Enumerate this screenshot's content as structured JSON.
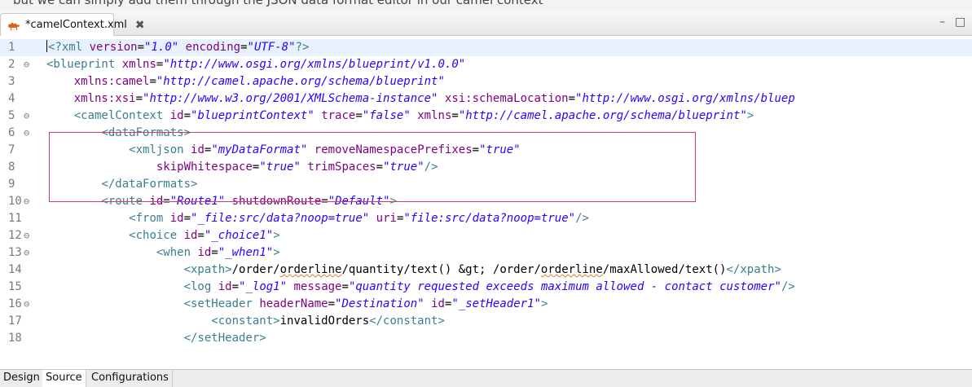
{
  "window": {
    "partial_top_text": "but we can simply add them through the JSON data format editor in our camel context"
  },
  "tab": {
    "title": "*camelContext.xml",
    "close_glyph": "✖"
  },
  "controls": {
    "minimize": "–",
    "maximize": "□"
  },
  "colors": {
    "tag": "#3a7f8f",
    "attribute": "#7f007f",
    "value": "#2a00ff",
    "highlight_box": "#d23c6a"
  },
  "lines": [
    {
      "num": "1",
      "fold": "",
      "tokens": [
        {
          "c": "t",
          "s": "<?xml"
        },
        {
          "c": "x",
          "s": " "
        },
        {
          "c": "a",
          "s": "version"
        },
        {
          "c": "x",
          "s": "="
        },
        {
          "c": "v",
          "s": "\"1.0\""
        },
        {
          "c": "x",
          "s": " "
        },
        {
          "c": "a",
          "s": "encoding"
        },
        {
          "c": "x",
          "s": "="
        },
        {
          "c": "v",
          "s": "\"UTF-8\""
        },
        {
          "c": "t",
          "s": "?>"
        }
      ]
    },
    {
      "num": "2",
      "fold": "⊖",
      "tokens": [
        {
          "c": "t",
          "s": "<blueprint"
        },
        {
          "c": "x",
          "s": " "
        },
        {
          "c": "a",
          "s": "xmlns"
        },
        {
          "c": "x",
          "s": "="
        },
        {
          "c": "v",
          "s": "\"http://www.osgi.org/xmlns/blueprint/v1.0.0\""
        }
      ]
    },
    {
      "num": "3",
      "fold": "",
      "tokens": [
        {
          "c": "x",
          "s": "    "
        },
        {
          "c": "a",
          "s": "xmlns:camel"
        },
        {
          "c": "x",
          "s": "="
        },
        {
          "c": "v",
          "s": "\"http://camel.apache.org/schema/blueprint\""
        }
      ]
    },
    {
      "num": "4",
      "fold": "",
      "tokens": [
        {
          "c": "x",
          "s": "    "
        },
        {
          "c": "a",
          "s": "xmlns:xsi"
        },
        {
          "c": "x",
          "s": "="
        },
        {
          "c": "v",
          "s": "\"http://www.w3.org/2001/XMLSchema-instance\""
        },
        {
          "c": "x",
          "s": " "
        },
        {
          "c": "a",
          "s": "xsi:schemaLocation"
        },
        {
          "c": "x",
          "s": "="
        },
        {
          "c": "v",
          "s": "\"http://www.osgi.org/xmlns/bluep"
        }
      ]
    },
    {
      "num": "5",
      "fold": "⊖",
      "tokens": [
        {
          "c": "x",
          "s": "    "
        },
        {
          "c": "t",
          "s": "<camelContext"
        },
        {
          "c": "x",
          "s": " "
        },
        {
          "c": "a",
          "s": "id"
        },
        {
          "c": "x",
          "s": "="
        },
        {
          "c": "v",
          "s": "\"blueprintContext\""
        },
        {
          "c": "x",
          "s": " "
        },
        {
          "c": "a",
          "s": "trace"
        },
        {
          "c": "x",
          "s": "="
        },
        {
          "c": "v",
          "s": "\"false\""
        },
        {
          "c": "x",
          "s": " "
        },
        {
          "c": "a",
          "s": "xmlns"
        },
        {
          "c": "x",
          "s": "="
        },
        {
          "c": "v",
          "s": "\"http://camel.apache.org/schema/blueprint\""
        },
        {
          "c": "t",
          "s": ">"
        }
      ]
    },
    {
      "num": "6",
      "fold": "⊖",
      "tokens": [
        {
          "c": "x",
          "s": "        "
        },
        {
          "c": "t",
          "s": "<dataFormats>"
        }
      ]
    },
    {
      "num": "7",
      "fold": "",
      "tokens": [
        {
          "c": "x",
          "s": "            "
        },
        {
          "c": "t",
          "s": "<xmljson"
        },
        {
          "c": "x",
          "s": " "
        },
        {
          "c": "a",
          "s": "id"
        },
        {
          "c": "x",
          "s": "="
        },
        {
          "c": "v",
          "s": "\"myDataFormat\""
        },
        {
          "c": "x",
          "s": " "
        },
        {
          "c": "a",
          "s": "removeNamespacePrefixes"
        },
        {
          "c": "x",
          "s": "="
        },
        {
          "c": "v",
          "s": "\"true\""
        }
      ]
    },
    {
      "num": "8",
      "fold": "",
      "tokens": [
        {
          "c": "x",
          "s": "                "
        },
        {
          "c": "a",
          "s": "skipWhitespace"
        },
        {
          "c": "x",
          "s": "="
        },
        {
          "c": "v",
          "s": "\"true\""
        },
        {
          "c": "x",
          "s": " "
        },
        {
          "c": "a",
          "s": "trimSpaces"
        },
        {
          "c": "x",
          "s": "="
        },
        {
          "c": "v",
          "s": "\"true\""
        },
        {
          "c": "t",
          "s": "/>"
        }
      ]
    },
    {
      "num": "9",
      "fold": "",
      "tokens": [
        {
          "c": "x",
          "s": "        "
        },
        {
          "c": "t",
          "s": "</dataFormats>"
        }
      ]
    },
    {
      "num": "10",
      "fold": "⊖",
      "tokens": [
        {
          "c": "x",
          "s": "        "
        },
        {
          "c": "t",
          "s": "<route"
        },
        {
          "c": "x",
          "s": " "
        },
        {
          "c": "a",
          "s": "id"
        },
        {
          "c": "x",
          "s": "="
        },
        {
          "c": "v",
          "s": "\"Route1\""
        },
        {
          "c": "x",
          "s": " "
        },
        {
          "c": "a",
          "s": "shutdownRoute"
        },
        {
          "c": "x",
          "s": "="
        },
        {
          "c": "v",
          "s": "\"Default\""
        },
        {
          "c": "t",
          "s": ">"
        }
      ]
    },
    {
      "num": "11",
      "fold": "",
      "tokens": [
        {
          "c": "x",
          "s": "            "
        },
        {
          "c": "t",
          "s": "<from"
        },
        {
          "c": "x",
          "s": " "
        },
        {
          "c": "a",
          "s": "id"
        },
        {
          "c": "x",
          "s": "="
        },
        {
          "c": "v",
          "s": "\"_file:src/data?noop=true\""
        },
        {
          "c": "x",
          "s": " "
        },
        {
          "c": "a",
          "s": "uri"
        },
        {
          "c": "x",
          "s": "="
        },
        {
          "c": "v",
          "s": "\"file:src/data?noop=true\""
        },
        {
          "c": "t",
          "s": "/>"
        }
      ]
    },
    {
      "num": "12",
      "fold": "⊖",
      "tokens": [
        {
          "c": "x",
          "s": "            "
        },
        {
          "c": "t",
          "s": "<choice"
        },
        {
          "c": "x",
          "s": " "
        },
        {
          "c": "a",
          "s": "id"
        },
        {
          "c": "x",
          "s": "="
        },
        {
          "c": "v",
          "s": "\"_choice1\""
        },
        {
          "c": "t",
          "s": ">"
        }
      ]
    },
    {
      "num": "13",
      "fold": "⊖",
      "tokens": [
        {
          "c": "x",
          "s": "                "
        },
        {
          "c": "t",
          "s": "<when"
        },
        {
          "c": "x",
          "s": " "
        },
        {
          "c": "a",
          "s": "id"
        },
        {
          "c": "x",
          "s": "="
        },
        {
          "c": "v",
          "s": "\"_when1\""
        },
        {
          "c": "t",
          "s": ">"
        }
      ]
    },
    {
      "num": "14",
      "fold": "",
      "tokens": [
        {
          "c": "x",
          "s": "                    "
        },
        {
          "c": "t",
          "s": "<xpath>"
        },
        {
          "c": "x",
          "s": "/order/"
        },
        {
          "c": "xs",
          "s": "orderline"
        },
        {
          "c": "x",
          "s": "/quantity/text() &gt; /order/"
        },
        {
          "c": "xs",
          "s": "orderline"
        },
        {
          "c": "x",
          "s": "/maxAllowed/text()"
        },
        {
          "c": "t",
          "s": "</xpath>"
        }
      ]
    },
    {
      "num": "15",
      "fold": "",
      "tokens": [
        {
          "c": "x",
          "s": "                    "
        },
        {
          "c": "t",
          "s": "<log"
        },
        {
          "c": "x",
          "s": " "
        },
        {
          "c": "a",
          "s": "id"
        },
        {
          "c": "x",
          "s": "="
        },
        {
          "c": "v",
          "s": "\"_log1\""
        },
        {
          "c": "x",
          "s": " "
        },
        {
          "c": "a",
          "s": "message"
        },
        {
          "c": "x",
          "s": "="
        },
        {
          "c": "v",
          "s": "\"quantity requested exceeds maximum allowed - contact customer\""
        },
        {
          "c": "t",
          "s": "/>"
        }
      ]
    },
    {
      "num": "16",
      "fold": "⊖",
      "tokens": [
        {
          "c": "x",
          "s": "                    "
        },
        {
          "c": "t",
          "s": "<setHeader"
        },
        {
          "c": "x",
          "s": " "
        },
        {
          "c": "a",
          "s": "headerName"
        },
        {
          "c": "x",
          "s": "="
        },
        {
          "c": "v",
          "s": "\"Destination\""
        },
        {
          "c": "x",
          "s": " "
        },
        {
          "c": "a",
          "s": "id"
        },
        {
          "c": "x",
          "s": "="
        },
        {
          "c": "v",
          "s": "\"_setHeader1\""
        },
        {
          "c": "t",
          "s": ">"
        }
      ]
    },
    {
      "num": "17",
      "fold": "",
      "tokens": [
        {
          "c": "x",
          "s": "                        "
        },
        {
          "c": "t",
          "s": "<constant>"
        },
        {
          "c": "x",
          "s": "invalidOrders"
        },
        {
          "c": "t",
          "s": "</constant>"
        }
      ]
    },
    {
      "num": "18",
      "fold": "",
      "tokens": [
        {
          "c": "x",
          "s": "                    "
        },
        {
          "c": "t",
          "s": "</setHeader>"
        }
      ]
    }
  ],
  "bottom_tabs": [
    {
      "label": "Design",
      "active": false
    },
    {
      "label": "Source",
      "active": true
    },
    {
      "label": "Configurations",
      "active": false
    }
  ]
}
